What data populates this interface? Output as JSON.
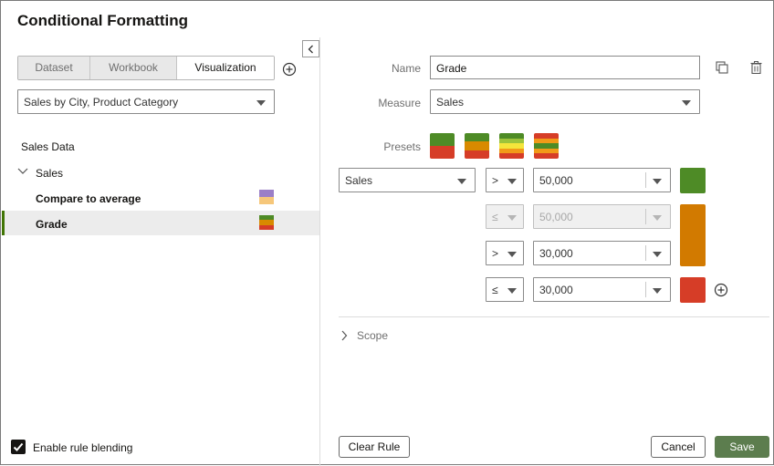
{
  "dialog": {
    "title": "Conditional Formatting"
  },
  "left": {
    "tabs": [
      "Dataset",
      "Workbook",
      "Visualization"
    ],
    "selected_tab": "Visualization",
    "source_select": "Sales by City, Product Category",
    "tree": {
      "root": "Sales Data",
      "group": "Sales",
      "rules": [
        {
          "label": "Compare to average",
          "colors": [
            "#9b7fc7",
            "#f6c77a"
          ]
        },
        {
          "label": "Grade",
          "colors": [
            "#4e8b26",
            "#d88a00",
            "#d63d27"
          ],
          "selected": true
        }
      ]
    },
    "enable_blending_label": "Enable rule blending",
    "enable_blending_checked": true
  },
  "right": {
    "name_label": "Name",
    "name_value": "Grade",
    "measure_label": "Measure",
    "measure_value": "Sales",
    "presets_label": "Presets",
    "presets": [
      [
        "#4e8b26",
        "#d63d27"
      ],
      [
        "#4e8b26",
        "#d88a00",
        "#d63d27"
      ],
      [
        "#4e8b26",
        "#9cc33b",
        "#f4e53b",
        "#f19a18",
        "#d63d27"
      ],
      [
        "#d63d27",
        "#f19a18",
        "#4e8b26",
        "#f19a18",
        "#d63d27"
      ]
    ],
    "conditions": [
      {
        "measure": "Sales",
        "op": ">",
        "value": "50,000",
        "disabled": false
      },
      {
        "measure": "",
        "op": "≤",
        "value": "50,000",
        "disabled": true
      },
      {
        "measure": "",
        "op": ">",
        "value": "30,000",
        "disabled": false
      },
      {
        "measure": "",
        "op": "≤",
        "value": "30,000",
        "disabled": false
      }
    ],
    "colors": {
      "green": "#4e8b26",
      "orange": "#d27a00",
      "red": "#d63d27"
    },
    "scope_label": "Scope"
  },
  "buttons": {
    "clear_rule": "Clear Rule",
    "cancel": "Cancel",
    "save": "Save"
  }
}
